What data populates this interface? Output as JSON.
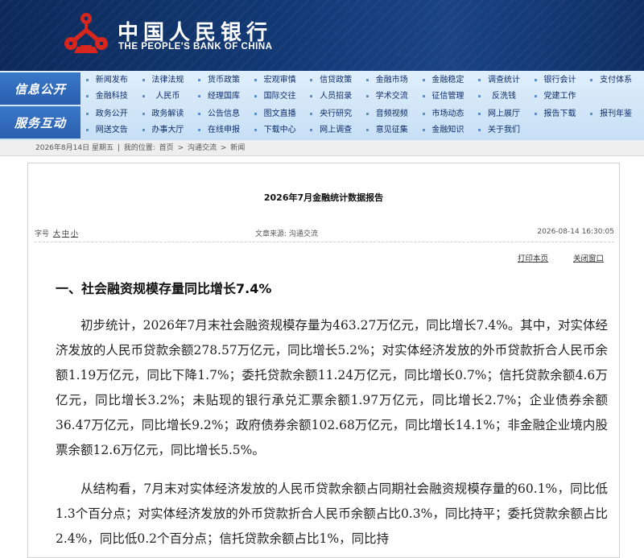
{
  "header": {
    "bank_name_cn": "中国人民银行",
    "bank_name_en": "THE PEOPLE'S BANK OF CHINA",
    "logo_icon": "pboc-emblem-icon"
  },
  "nav": {
    "groups": [
      {
        "label": "信息公开",
        "rows": [
          [
            "新闻发布",
            "法律法规",
            "货币政策",
            "宏观审慎",
            "信贷政策",
            "金融市场",
            "金融稳定",
            "调查统计",
            "银行会计",
            "支付体系"
          ],
          [
            "金融科技",
            "人民币",
            "经理国库",
            "国际交往",
            "人员招录",
            "学术交流",
            "征信管理",
            "反洗钱",
            "党建工作",
            ""
          ]
        ]
      },
      {
        "label": "服务互动",
        "rows": [
          [
            "政务公开",
            "政务解读",
            "公告信息",
            "图文直播",
            "央行研究",
            "音频视频",
            "市场动态",
            "网上展厅",
            "报告下载",
            "报刊年鉴"
          ],
          [
            "网送文告",
            "办事大厅",
            "在线申报",
            "下载中心",
            "网上调查",
            "意见征集",
            "金融知识",
            "关于我们",
            "",
            ""
          ]
        ]
      }
    ]
  },
  "breadcrumb": {
    "date": "2026年8月14日 星期五",
    "location_label": "我的位置:",
    "items": [
      "首页",
      "沟通交流",
      "新闻"
    ],
    "separator": " > "
  },
  "article": {
    "title": "2026年7月金融统计数据报告",
    "font_size_label": "字号",
    "font_sizes": [
      "大",
      "中",
      "小"
    ],
    "source": "文章来源:  沟通交流",
    "date": "2026-08-14 16:30:05",
    "print_label": "打印本页",
    "close_label": "关闭窗口",
    "section_heading": "一、社会融资规模存量同比增长7.4%",
    "paragraph1": "初步统计，2026年7月末社会融资规模存量为463.27万亿元，同比增长7.4%。其中，对实体经济发放的人民币贷款余额278.57万亿元，同比增长5.2%；对实体经济发放的外币贷款折合人民币余额1.19万亿元，同比下降1.7%；委托贷款余额11.24万亿元，同比增长0.7%；信托贷款余额4.6万亿元，同比增长3.2%；未贴现的银行承兑汇票余额1.97万亿元，同比增长2.7%；企业债券余额36.47万亿元，同比增长9.2%；政府债券余额102.68万亿元，同比增长14.1%；非金融企业境内股票余额12.6万亿元，同比增长5.5%。",
    "paragraph2": "从结构看，7月末对实体经济发放的人民币贷款余额占同期社会融资规模存量的60.1%，同比低1.3个百分点；对实体经济发放的外币贷款折合人民币余额占比0.3%，同比持平；委托贷款余额占比2.4%，同比低0.2个百分点；信托贷款余额占比1%，同比持"
  }
}
